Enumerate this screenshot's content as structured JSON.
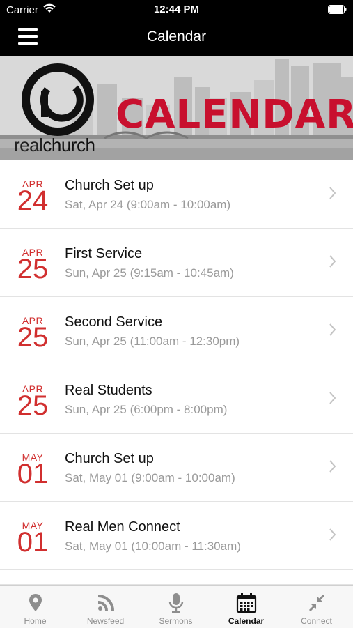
{
  "status_bar": {
    "carrier": "Carrier",
    "time": "12:44 PM"
  },
  "nav": {
    "title": "Calendar",
    "menu_icon": "hamburger-menu-icon"
  },
  "banner": {
    "logo_light": "real",
    "logo_bold": "church",
    "headline": "CALENDAR",
    "headline_color": "#c8102e"
  },
  "events": [
    {
      "month": "APR",
      "day": "24",
      "title": "Church Set up",
      "subtitle": "Sat, Apr 24 (9:00am - 10:00am)"
    },
    {
      "month": "APR",
      "day": "25",
      "title": "First Service",
      "subtitle": "Sun, Apr 25 (9:15am - 10:45am)"
    },
    {
      "month": "APR",
      "day": "25",
      "title": "Second Service",
      "subtitle": "Sun, Apr 25 (11:00am - 12:30pm)"
    },
    {
      "month": "APR",
      "day": "25",
      "title": "Real Students",
      "subtitle": "Sun, Apr 25 (6:00pm - 8:00pm)"
    },
    {
      "month": "MAY",
      "day": "01",
      "title": "Church Set up",
      "subtitle": "Sat, May 01 (9:00am - 10:00am)"
    },
    {
      "month": "MAY",
      "day": "01",
      "title": "Real Men Connect",
      "subtitle": "Sat, May 01 (10:00am - 11:30am)"
    }
  ],
  "accent_color": "#d12f2f",
  "tabs": [
    {
      "label": "Home",
      "icon": "map-pin-icon",
      "active": false
    },
    {
      "label": "Newsfeed",
      "icon": "rss-icon",
      "active": false
    },
    {
      "label": "Sermons",
      "icon": "microphone-icon",
      "active": false
    },
    {
      "label": "Calendar",
      "icon": "calendar-icon",
      "active": true
    },
    {
      "label": "Connect",
      "icon": "arrows-in-icon",
      "active": false
    }
  ]
}
